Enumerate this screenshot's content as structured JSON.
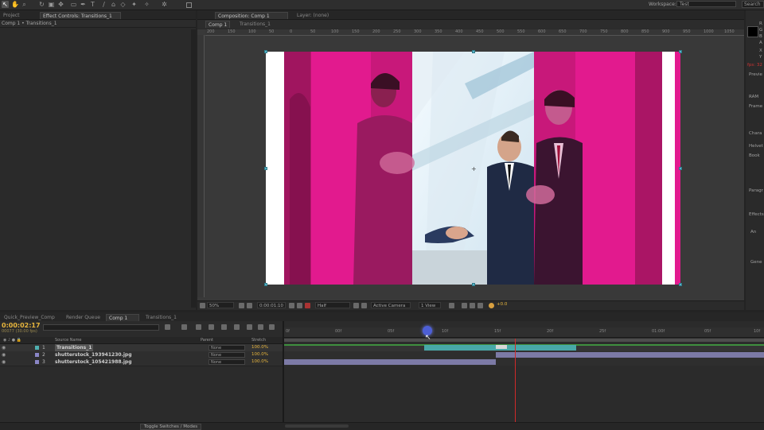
{
  "toolbar": {
    "tools": [
      "arrow-icon",
      "hand-icon",
      "zoom-icon",
      "rotate-icon",
      "camera-icon",
      "pan-behind-icon",
      "mask-icon",
      "pen-icon",
      "type-icon",
      "brush-icon",
      "clone-icon",
      "eraser-icon",
      "roto-icon",
      "puppet-icon"
    ],
    "workspace_label": "Workspace:",
    "workspace_value": "Test",
    "search_placeholder": "Search"
  },
  "left_panel": {
    "tabs": [
      "Project",
      "Effect Controls: Transitions_1"
    ],
    "subtitle": "Comp 1 • Transitions_1"
  },
  "composition": {
    "tab_label": "Composition: Comp 1",
    "layer_tab": "Layer: (none)",
    "breadcrumbs": [
      "Comp 1",
      "Transitions_1"
    ],
    "ruler_ticks": [
      "200",
      "150",
      "100",
      "50",
      "0",
      "50",
      "100",
      "150",
      "200",
      "250",
      "300",
      "350",
      "400",
      "450",
      "500",
      "550",
      "600",
      "650",
      "700",
      "750",
      "800",
      "850",
      "900",
      "950",
      "1000",
      "1050"
    ],
    "viewbar": {
      "zoom": "50%",
      "timecode": "0:00:01:10",
      "resolution": "Half",
      "camera": "Active Camera",
      "views": "1 View",
      "exposure": "+0.0"
    }
  },
  "right_panel": {
    "labels": [
      "R",
      "G",
      "B",
      "A",
      "X",
      "Y",
      "fps: 32",
      "Previe",
      "RAM",
      "Frame",
      "Chara",
      "Helvet",
      "Book",
      "Paragr",
      "Effects",
      "An",
      "Gene"
    ]
  },
  "timeline": {
    "tabs": [
      "Quick_Preview_Comp",
      "Render Queue",
      "Comp 1",
      "Transitions_1"
    ],
    "active_tab": "Comp 1",
    "timecode": "0:00:02:17",
    "timecode_frames": "00077 (30.00 fps)",
    "columns": {
      "source": "Source Name",
      "parent": "Parent",
      "stretch": "Stretch"
    },
    "ruler": [
      "0f",
      "00f",
      "05f",
      "10f",
      "15f",
      "20f",
      "25f",
      "01:00f",
      "05f",
      "10f"
    ],
    "layers": [
      {
        "num": "1",
        "name": "Transitions_1",
        "parent": "None",
        "stretch": "100.0%",
        "label_color": "#4fb0b0"
      },
      {
        "num": "2",
        "name": "shutterstock_193941230.jpg",
        "parent": "None",
        "stretch": "100.0%",
        "label_color": "#8a86c6"
      },
      {
        "num": "3",
        "name": "shutterstock_105421988.jpg",
        "parent": "None",
        "stretch": "100.0%",
        "label_color": "#8a86c6"
      }
    ],
    "bottom": {
      "toggle_label": "Toggle Switches / Modes"
    }
  },
  "colors": {
    "magenta": "#e0168a",
    "timecode": "#e8b63d",
    "playhead": "#d02a2a",
    "bar_teal": "#48a8a8",
    "bar_lavender": "#7c7aa6"
  }
}
